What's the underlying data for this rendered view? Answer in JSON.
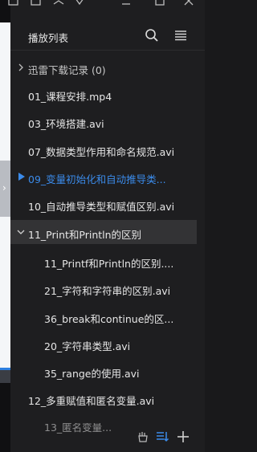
{
  "left_strip": {
    "arrow": "›"
  },
  "panel": {
    "title": "播放列表",
    "icons": {
      "search": "search-icon",
      "menu": "list-menu-icon"
    }
  },
  "playlist": {
    "group_top": {
      "label": "迅雷下载记录 (0)"
    },
    "items": [
      {
        "label": "01_课程安排.mp4"
      },
      {
        "label": "03_环境搭建.avi"
      },
      {
        "label": "07_数据类型作用和命名规范.avi"
      },
      {
        "label": "09_变量初始化和自动推导类...",
        "active": true
      },
      {
        "label": "10_自动推导类型和赋值区别.avi"
      }
    ],
    "folder": {
      "label": "11_Print和Println的区别"
    },
    "sub_items": [
      {
        "label": "11_Printf和Println的区别...."
      },
      {
        "label": "21_字符和字符串的区别.avi"
      },
      {
        "label": "36_break和continue的区..."
      },
      {
        "label": "20_字符串类型.avi"
      },
      {
        "label": "35_range的使用.avi"
      }
    ],
    "after_items": [
      {
        "label": "12_多重赋值和匿名变量.avi"
      },
      {
        "label": "13_匿名变量..."
      }
    ]
  },
  "bottom": {
    "icons": [
      "clean-icon",
      "sort-icon",
      "add-icon"
    ]
  },
  "colors": {
    "accent": "#3b8bea",
    "panel_bg": "#1e1e20",
    "selected_row": "#333335"
  }
}
